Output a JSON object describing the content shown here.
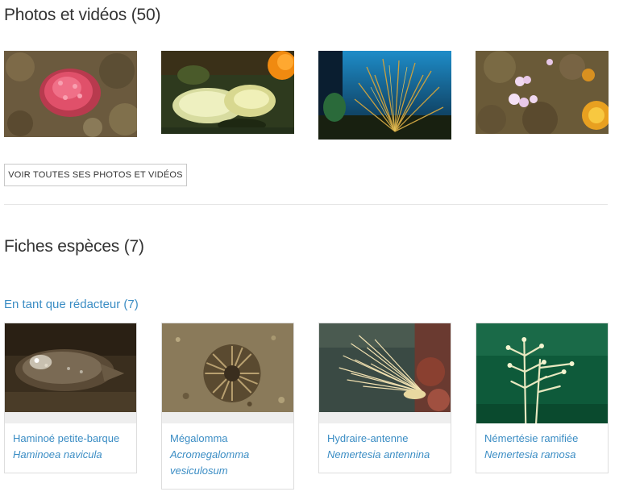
{
  "photos_section": {
    "title": "Photos et vidéos (50)",
    "photos": [
      {
        "label": "photo-1"
      },
      {
        "label": "photo-2"
      },
      {
        "label": "photo-3"
      },
      {
        "label": "photo-4"
      }
    ],
    "view_all_label": "VOIR TOUTES SES PHOTOS ET VIDÉOS"
  },
  "species_section": {
    "title": "Fiches espèces (7)",
    "subtitle": "En tant que rédacteur (7)",
    "cards": [
      {
        "common_name": "Haminoé petite-barque",
        "latin_name": "Haminoea navicula"
      },
      {
        "common_name": "Mégalomma",
        "latin_name": "Acromegalomma vesiculosum"
      },
      {
        "common_name": "Hydraire-antenne",
        "latin_name": "Nemertesia antennina"
      },
      {
        "common_name": "Némertésie ramifiée",
        "latin_name": "Nemertesia ramosa"
      }
    ]
  },
  "colors": {
    "link": "#3b8dc4",
    "text": "#333333",
    "border": "#dddddd"
  }
}
